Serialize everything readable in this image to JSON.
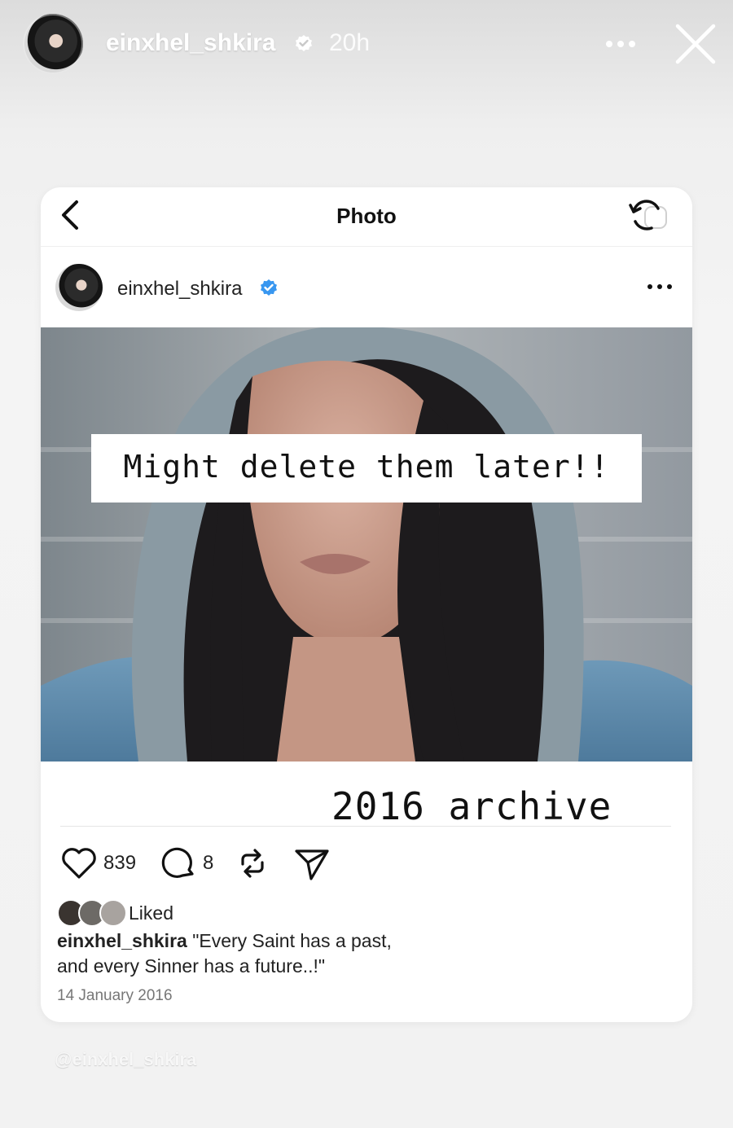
{
  "story": {
    "username": "einxhel_shkira",
    "time_ago": "20h"
  },
  "card": {
    "title": "Photo"
  },
  "post": {
    "username": "einxhel_shkira",
    "overlay_text": "Might delete them later!!",
    "archive_text": "2016 archive",
    "like_count": "839",
    "comment_count": "8",
    "liked_label": "Liked",
    "caption_user": "einxhel_shkira",
    "caption_line1": "\"Every Saint has a past,",
    "caption_line2": "and every Sinner has a future..!\"",
    "date": "14 January 2016"
  },
  "watermark": "@einxhel_shkira",
  "colors": {
    "verified": "#3897f0",
    "text": "#222222",
    "secondary": "#777777"
  }
}
